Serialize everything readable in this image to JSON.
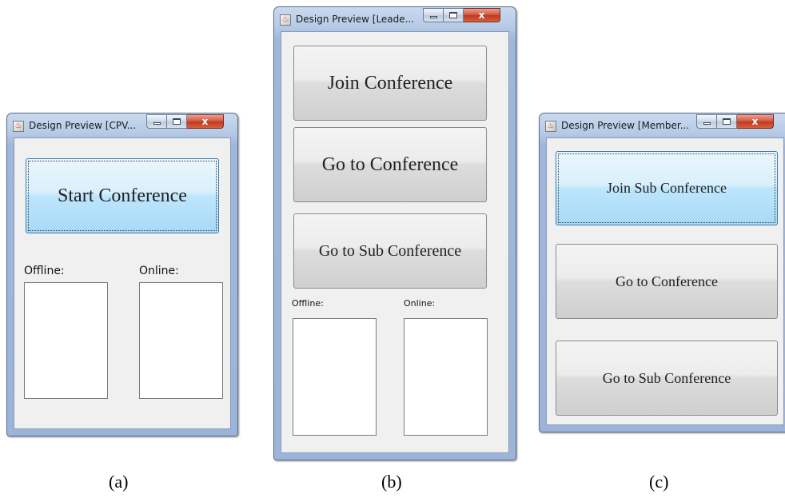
{
  "windows": {
    "a": {
      "title": "Design Preview [CPV...",
      "start_button": "Start Conference",
      "offline_label": "Offline:",
      "online_label": "Online:"
    },
    "b": {
      "title": "Design Preview [Leade...",
      "join_button": "Join Conference",
      "goto_button": "Go to Conference",
      "goto_sub_button": "Go to Sub Conference",
      "offline_label": "Offline:",
      "online_label": "Online:"
    },
    "c": {
      "title": "Design Preview [Member...",
      "join_sub_button": "Join Sub Conference",
      "goto_button": "Go to Conference",
      "goto_sub_button": "Go to Sub Conference"
    }
  },
  "window_controls": {
    "minimize_icon": "minimize-icon",
    "maximize_icon": "maximize-icon",
    "close_glyph": "x"
  },
  "captions": [
    "(a)",
    "(b)",
    "(c)"
  ]
}
